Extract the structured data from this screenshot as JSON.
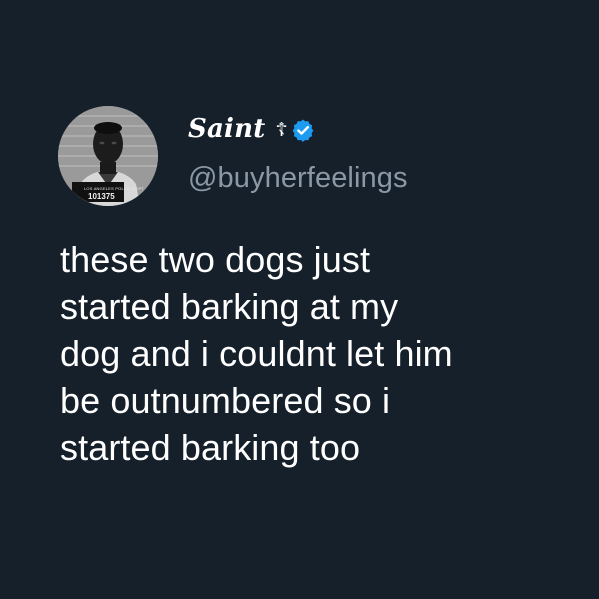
{
  "profile": {
    "display_name": "Saint",
    "name_symbol": "☦",
    "verified_icon": "verified-check-icon",
    "handle": "@buyherfeelings",
    "avatar": {
      "placard_top": "LOS ANGELES POLICE DEPT",
      "placard_number": "101375"
    }
  },
  "tweet": {
    "lines": [
      "these two dogs just",
      "started barking at my",
      "dog and i couldnt let him",
      "be outnumbered so i",
      "started barking too"
    ]
  },
  "colors": {
    "background": "#16202b",
    "text_primary": "#ffffff",
    "text_secondary": "#8b98a5",
    "verified_blue": "#1d9bf0"
  }
}
